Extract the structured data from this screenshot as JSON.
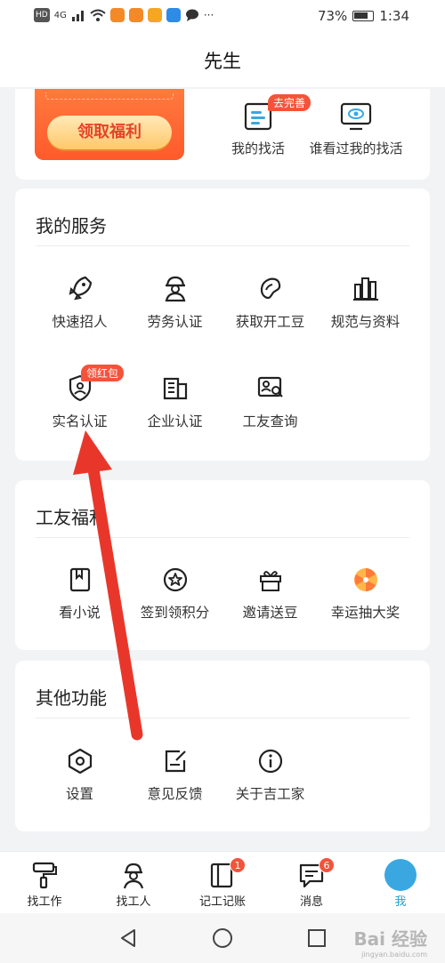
{
  "status_bar": {
    "battery": "73%",
    "time": "1:34",
    "network": "4G"
  },
  "header": {
    "title": "先生"
  },
  "top_card": {
    "promo_button": "领取福利",
    "my_jobs": "我的找活",
    "my_jobs_badge": "去完善",
    "viewers": "谁看过我的找活"
  },
  "my_services": {
    "title": "我的服务",
    "items": [
      {
        "label": "快速招人",
        "icon": "rocket-icon"
      },
      {
        "label": "劳务认证",
        "icon": "worker-helmet-icon"
      },
      {
        "label": "获取开工豆",
        "icon": "bean-icon"
      },
      {
        "label": "规范与资料",
        "icon": "books-icon"
      },
      {
        "label": "实名认证",
        "icon": "id-shield-icon",
        "badge": "领红包"
      },
      {
        "label": "企业认证",
        "icon": "building-icon"
      },
      {
        "label": "工友查询",
        "icon": "id-card-search-icon"
      }
    ]
  },
  "welfare": {
    "title": "工友福利",
    "items": [
      {
        "label": "看小说",
        "icon": "book-icon"
      },
      {
        "label": "签到领积分",
        "icon": "star-circle-icon"
      },
      {
        "label": "邀请送豆",
        "icon": "gift-icon"
      },
      {
        "label": "幸运抽大奖",
        "icon": "lucky-wheel-icon"
      }
    ]
  },
  "other": {
    "title": "其他功能",
    "items": [
      {
        "label": "设置",
        "icon": "settings-hexagon-icon"
      },
      {
        "label": "意见反馈",
        "icon": "feedback-edit-icon"
      },
      {
        "label": "关于吉工家",
        "icon": "info-icon"
      }
    ]
  },
  "bottom_nav": {
    "items": [
      {
        "label": "找工作",
        "icon": "paint-roller-icon"
      },
      {
        "label": "找工人",
        "icon": "worker-icon"
      },
      {
        "label": "记工记账",
        "icon": "ledger-icon",
        "badge": "1"
      },
      {
        "label": "消息",
        "icon": "message-icon",
        "badge": "6"
      },
      {
        "label": "我",
        "icon": "me-avatar-icon"
      }
    ],
    "active_color": "#25a0d8"
  },
  "watermark": {
    "text": "Bai 经验",
    "sub": "jingyan.baidu.com"
  },
  "colors": {
    "accent_red": "#f4533a",
    "promo_orange": "#ff6a33",
    "annotation_arrow": "#e8372a"
  }
}
